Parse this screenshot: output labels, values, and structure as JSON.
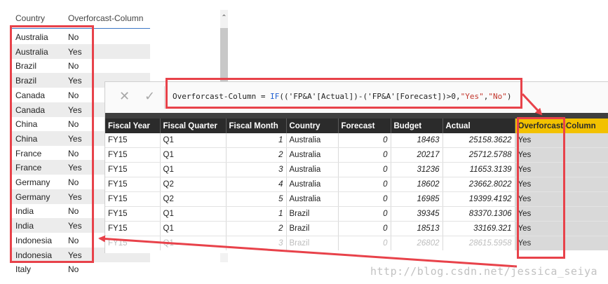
{
  "country_list": {
    "headers": [
      "Country",
      "Overforcast-Column"
    ],
    "rows": [
      [
        "Australia",
        "No"
      ],
      [
        "Australia",
        "Yes"
      ],
      [
        "Brazil",
        "No"
      ],
      [
        "Brazil",
        "Yes"
      ],
      [
        "Canada",
        "No"
      ],
      [
        "Canada",
        "Yes"
      ],
      [
        "China",
        "No"
      ],
      [
        "China",
        "Yes"
      ],
      [
        "France",
        "No"
      ],
      [
        "France",
        "Yes"
      ],
      [
        "Germany",
        "No"
      ],
      [
        "Germany",
        "Yes"
      ],
      [
        "India",
        "No"
      ],
      [
        "India",
        "Yes"
      ],
      [
        "Indonesia",
        "No"
      ],
      [
        "Indonesia",
        "Yes"
      ],
      [
        "Italy",
        "No"
      ]
    ]
  },
  "formula_bar": {
    "cancel_glyph": "✕",
    "commit_glyph": "✓",
    "formula_prefix": "Overforcast-Column = ",
    "formula_fn": "IF",
    "formula_paren": "(",
    "formula_body": "('FP&A'[Actual])-('FP&A'[Forecast])>0,",
    "formula_yes": "\"Yes\"",
    "formula_comma": ",",
    "formula_no": "\"No\"",
    "formula_close": ")"
  },
  "data_table": {
    "columns": [
      "Fiscal Year",
      "Fiscal Quarter",
      "Fiscal Month",
      "Country",
      "Forecast",
      "Budget",
      "Actual",
      "Overforcast-Column"
    ],
    "rows": [
      [
        "FY15",
        "Q1",
        "1",
        "Australia",
        "0",
        "18463",
        "25158.3622",
        "Yes"
      ],
      [
        "FY15",
        "Q1",
        "2",
        "Australia",
        "0",
        "20217",
        "25712.5788",
        "Yes"
      ],
      [
        "FY15",
        "Q1",
        "3",
        "Australia",
        "0",
        "31236",
        "11653.3139",
        "Yes"
      ],
      [
        "FY15",
        "Q2",
        "4",
        "Australia",
        "0",
        "18602",
        "23662.8022",
        "Yes"
      ],
      [
        "FY15",
        "Q2",
        "5",
        "Australia",
        "0",
        "16985",
        "19399.4192",
        "Yes"
      ],
      [
        "FY15",
        "Q1",
        "1",
        "Brazil",
        "0",
        "39345",
        "83370.1306",
        "Yes"
      ],
      [
        "FY15",
        "Q1",
        "2",
        "Brazil",
        "0",
        "18513",
        "33169.321",
        "Yes"
      ],
      [
        "FY15",
        "Q1",
        "3",
        "Brazil",
        "0",
        "26802",
        "28615.5958",
        "Yes"
      ]
    ]
  },
  "watermark": "http://blog.csdn.net/jessica_seiya",
  "colors": {
    "highlight_red": "#e8424a",
    "header_dark": "#2b2b2b",
    "header_highlight": "#f2c100",
    "keyword_blue": "#1f5fd1",
    "string_red": "#c2352b"
  }
}
